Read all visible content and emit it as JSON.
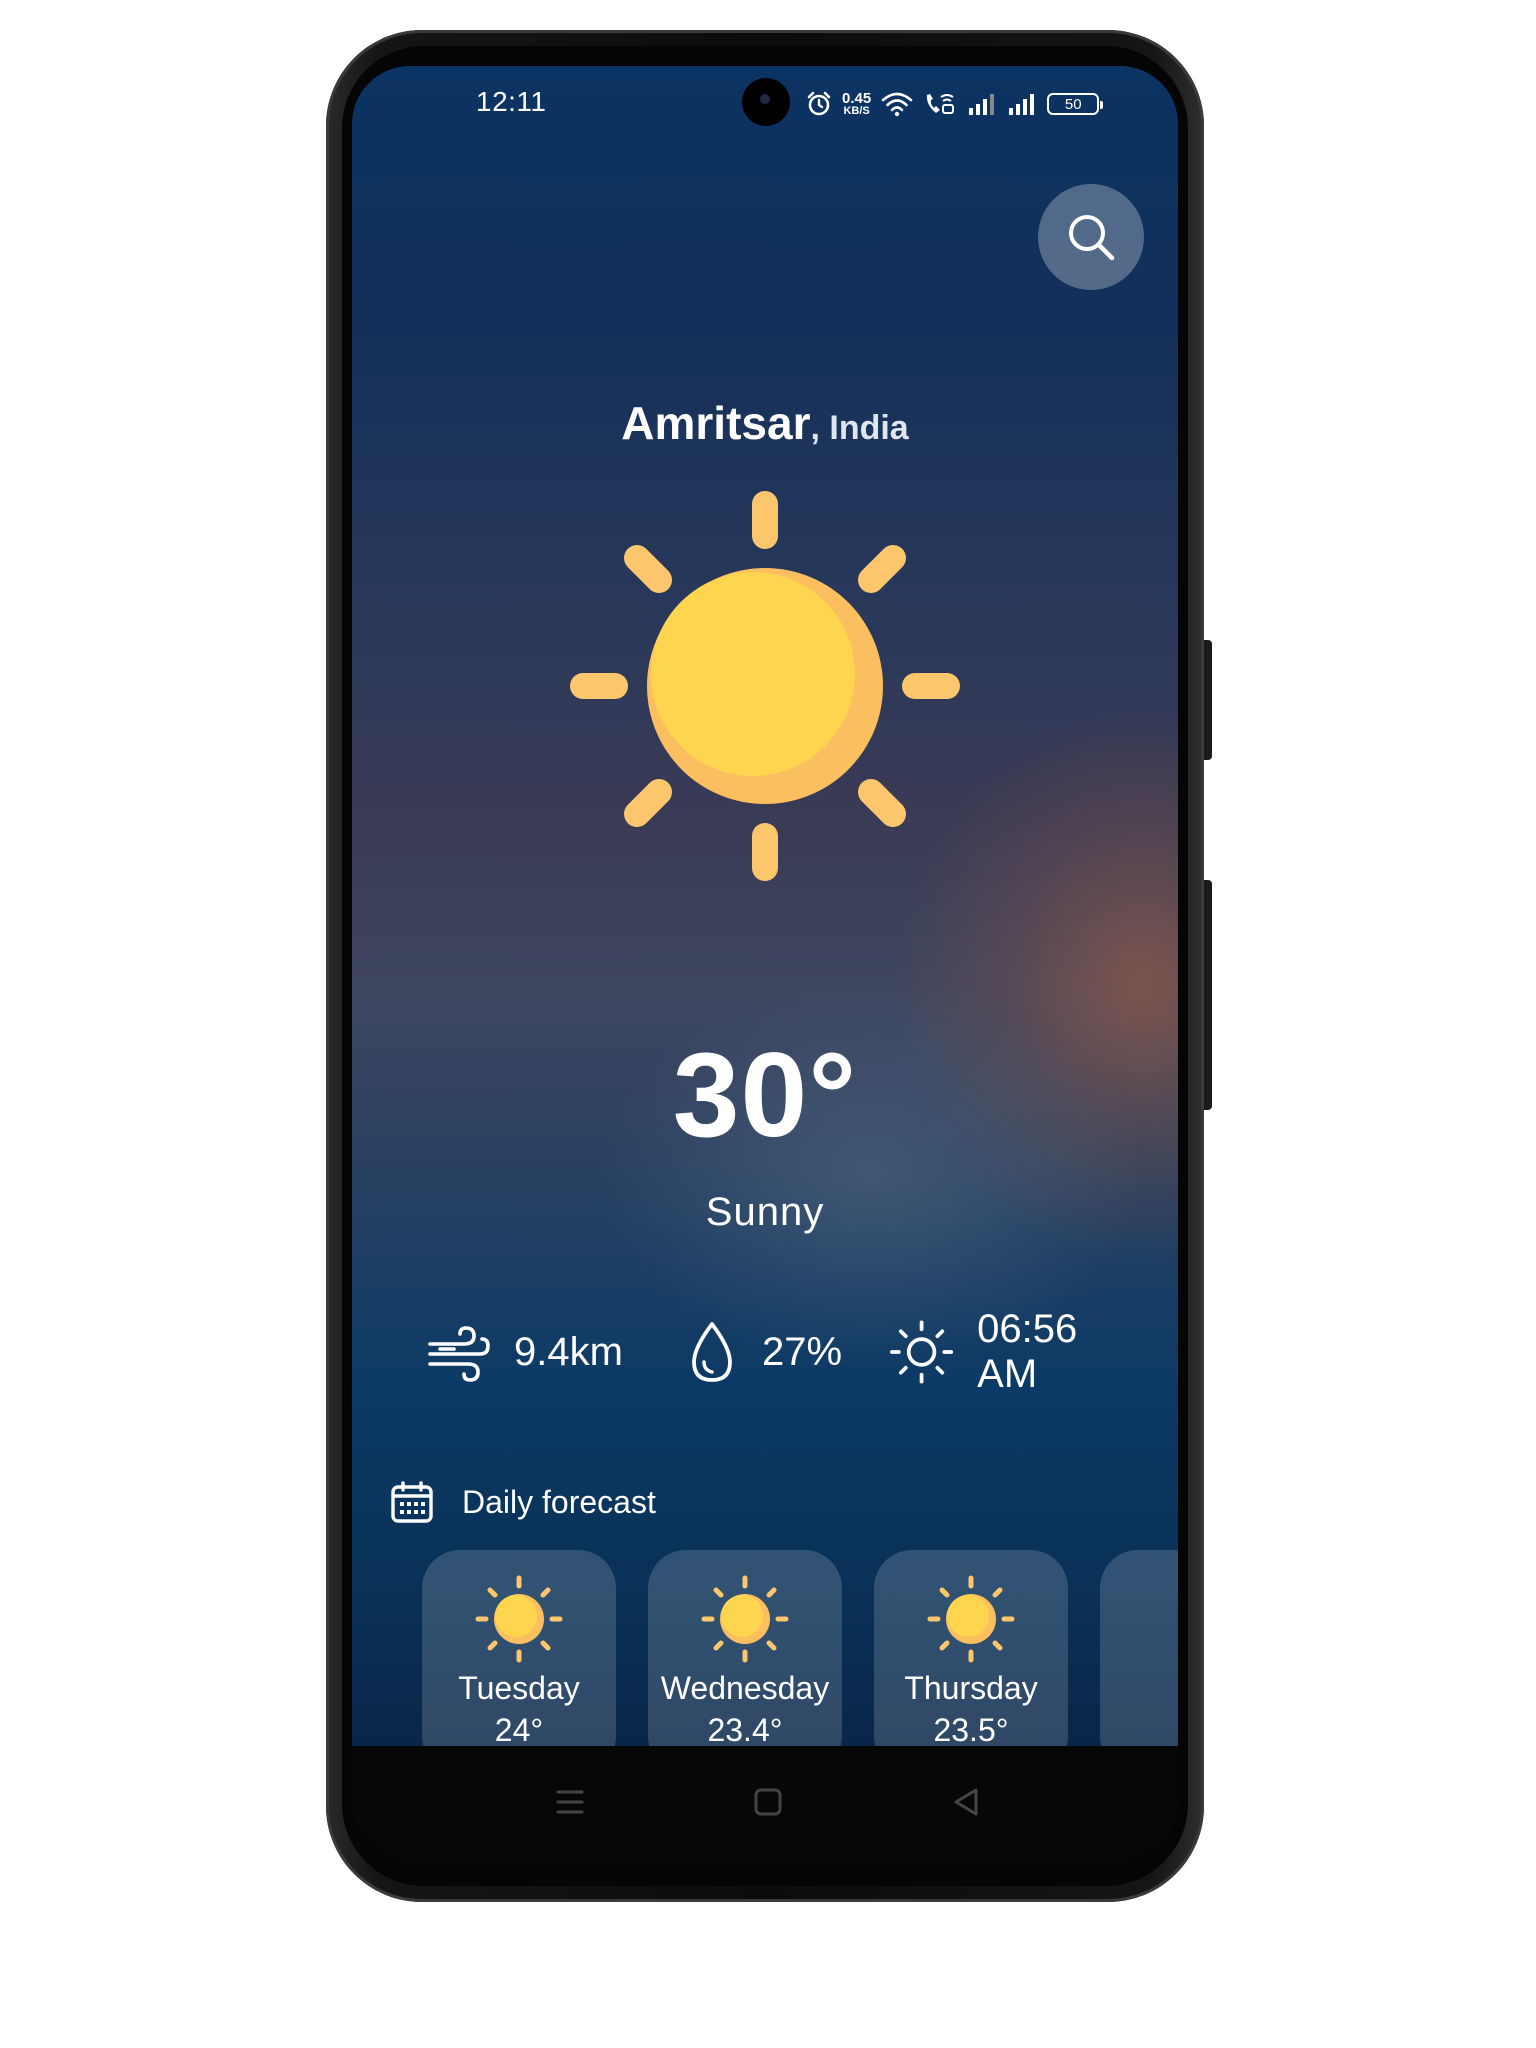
{
  "statusbar": {
    "time": "12:11",
    "net_speed_value": "0.45",
    "net_speed_unit": "KB/S",
    "battery": "50",
    "icons": [
      "alarm-icon",
      "wifi-icon",
      "wifi-calling-icon",
      "signal-icon",
      "signal-icon"
    ]
  },
  "header": {
    "search_icon": "search-icon"
  },
  "location": {
    "city": "Amritsar",
    "country": ", India"
  },
  "current": {
    "icon": "sun-icon",
    "temperature": "30°",
    "condition": "Sunny"
  },
  "stats": {
    "wind": {
      "icon": "wind-icon",
      "value": "9.4km"
    },
    "humidity": {
      "icon": "droplet-icon",
      "value": "27%"
    },
    "sunrise": {
      "icon": "sunrise-icon",
      "value": "06:56 AM"
    }
  },
  "forecast": {
    "title": "Daily forecast",
    "icon": "calendar-icon",
    "days": [
      {
        "day": "Tuesday",
        "temp": "24°",
        "icon": "sun-icon"
      },
      {
        "day": "Wednesday",
        "temp": "23.4°",
        "icon": "sun-icon"
      },
      {
        "day": "Thursday",
        "temp": "23.5°",
        "icon": "sun-icon"
      }
    ]
  },
  "navbar": {
    "items": [
      "menu-icon",
      "home-icon",
      "back-icon"
    ]
  },
  "colors": {
    "sun": "#fdd54f",
    "sun_shade": "#fbbf60",
    "rays": "#fcc66c",
    "text": "#ffffff"
  }
}
